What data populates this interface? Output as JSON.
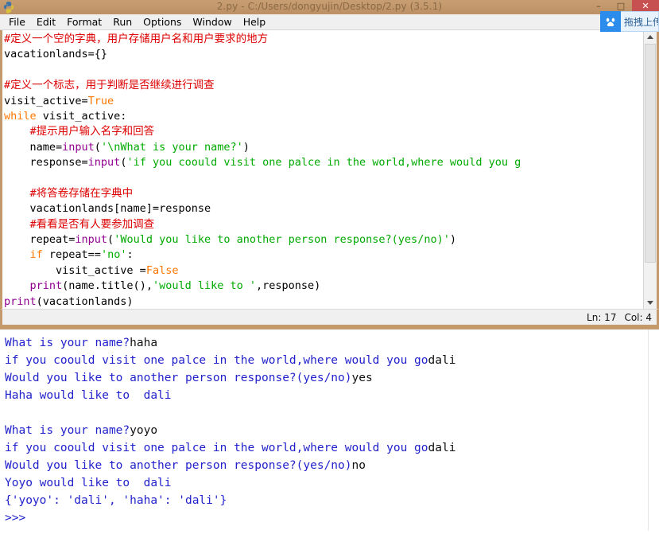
{
  "window": {
    "title": "2.py - C:/Users/dongyujin/Desktop/2.py (3.5.1)",
    "app_icon": "python-idle-icon",
    "minimize_glyph": "–",
    "maximize_glyph": "□",
    "close_glyph": "✕",
    "accent_frame_color": "#c49a6c",
    "titlebar_text_color": "#8a6a45",
    "close_button_color": "#c75050"
  },
  "menubar": {
    "items": [
      {
        "label": "File"
      },
      {
        "label": "Edit"
      },
      {
        "label": "Format"
      },
      {
        "label": "Run"
      },
      {
        "label": "Options"
      },
      {
        "label": "Window"
      },
      {
        "label": "Help"
      }
    ]
  },
  "netdisk_widget": {
    "icon": "baidu-netdisk-icon",
    "label": "拖拽上传",
    "icon_bg": "#2b8ceb"
  },
  "editor": {
    "syntax_colors": {
      "comment": "#dd0000",
      "keyword": "#ff7700",
      "string": "#00aa00",
      "builtin": "#900090",
      "definition": "#0000ff",
      "plain": "#000000"
    },
    "lines": [
      [
        {
          "t": "#定义一个空的字典，用户存储用户名和用户要求的地方",
          "c": "comment"
        }
      ],
      [
        {
          "t": "vacationlands={}",
          "c": "plain"
        }
      ],
      [
        {
          "t": "",
          "c": "plain"
        }
      ],
      [
        {
          "t": "#定义一个标志，用于判断是否继续进行调查",
          "c": "comment"
        }
      ],
      [
        {
          "t": "visit_active=",
          "c": "plain"
        },
        {
          "t": "True",
          "c": "keyword"
        }
      ],
      [
        {
          "t": "while",
          "c": "keyword"
        },
        {
          "t": " visit_active:",
          "c": "plain"
        }
      ],
      [
        {
          "t": "    #提示用户输入名字和回答",
          "c": "comment"
        }
      ],
      [
        {
          "t": "    name=",
          "c": "plain"
        },
        {
          "t": "input",
          "c": "builtin"
        },
        {
          "t": "(",
          "c": "plain"
        },
        {
          "t": "'\\nWhat is your name?'",
          "c": "string"
        },
        {
          "t": ")",
          "c": "plain"
        }
      ],
      [
        {
          "t": "    response=",
          "c": "plain"
        },
        {
          "t": "input",
          "c": "builtin"
        },
        {
          "t": "(",
          "c": "plain"
        },
        {
          "t": "'if you coould visit one palce in the world,where would you g",
          "c": "string"
        }
      ],
      [
        {
          "t": "",
          "c": "plain"
        }
      ],
      [
        {
          "t": "    #将答卷存储在字典中",
          "c": "comment"
        }
      ],
      [
        {
          "t": "    vacationlands[name]=response",
          "c": "plain"
        }
      ],
      [
        {
          "t": "    #看看是否有人要参加调查",
          "c": "comment"
        }
      ],
      [
        {
          "t": "    repeat=",
          "c": "plain"
        },
        {
          "t": "input",
          "c": "builtin"
        },
        {
          "t": "(",
          "c": "plain"
        },
        {
          "t": "'Would you like to another person response?(yes/no)'",
          "c": "string"
        },
        {
          "t": ")",
          "c": "plain"
        }
      ],
      [
        {
          "t": "    ",
          "c": "plain"
        },
        {
          "t": "if",
          "c": "keyword"
        },
        {
          "t": " repeat==",
          "c": "plain"
        },
        {
          "t": "'no'",
          "c": "string"
        },
        {
          "t": ":",
          "c": "plain"
        }
      ],
      [
        {
          "t": "        visit_active =",
          "c": "plain"
        },
        {
          "t": "False",
          "c": "keyword"
        }
      ],
      [
        {
          "t": "    ",
          "c": "plain"
        },
        {
          "t": "print",
          "c": "builtin"
        },
        {
          "t": "(name.title(),",
          "c": "plain"
        },
        {
          "t": "'would like to '",
          "c": "string"
        },
        {
          "t": ",response)",
          "c": "plain"
        }
      ],
      [
        {
          "t": "print",
          "c": "builtin"
        },
        {
          "t": "(vacationlands)",
          "c": "plain"
        }
      ]
    ],
    "scrollbar": {
      "vertical_present": true,
      "up_arrow": "scroll-up-arrow",
      "down_arrow": "scroll-down-arrow"
    }
  },
  "statusbar": {
    "line_label": "Ln: 17",
    "col_label": "Col: 4"
  },
  "shell": {
    "output_color": "#0000cc",
    "input_color": "#111111",
    "lines": [
      [
        {
          "t": "What is your name?",
          "c": "prompt"
        },
        {
          "t": "haha",
          "c": "input"
        }
      ],
      [
        {
          "t": "if you coould visit one palce in the world,where would you go",
          "c": "prompt"
        },
        {
          "t": "dali",
          "c": "input"
        }
      ],
      [
        {
          "t": "Would you like to another person response?(yes/no)",
          "c": "prompt"
        },
        {
          "t": "yes",
          "c": "input"
        }
      ],
      [
        {
          "t": "Haha would like to  dali",
          "c": "prompt"
        }
      ],
      [
        {
          "t": "",
          "c": "prompt"
        }
      ],
      [
        {
          "t": "What is your name?",
          "c": "prompt"
        },
        {
          "t": "yoyo",
          "c": "input"
        }
      ],
      [
        {
          "t": "if you coould visit one palce in the world,where would you go",
          "c": "prompt"
        },
        {
          "t": "dali",
          "c": "input"
        }
      ],
      [
        {
          "t": "Would you like to another person response?(yes/no)",
          "c": "prompt"
        },
        {
          "t": "no",
          "c": "input"
        }
      ],
      [
        {
          "t": "Yoyo would like to  dali",
          "c": "prompt"
        }
      ],
      [
        {
          "t": "{'yoyo': 'dali', 'haha': 'dali'}",
          "c": "prompt"
        }
      ],
      [
        {
          "t": ">>>",
          "c": "prompt"
        }
      ]
    ]
  }
}
